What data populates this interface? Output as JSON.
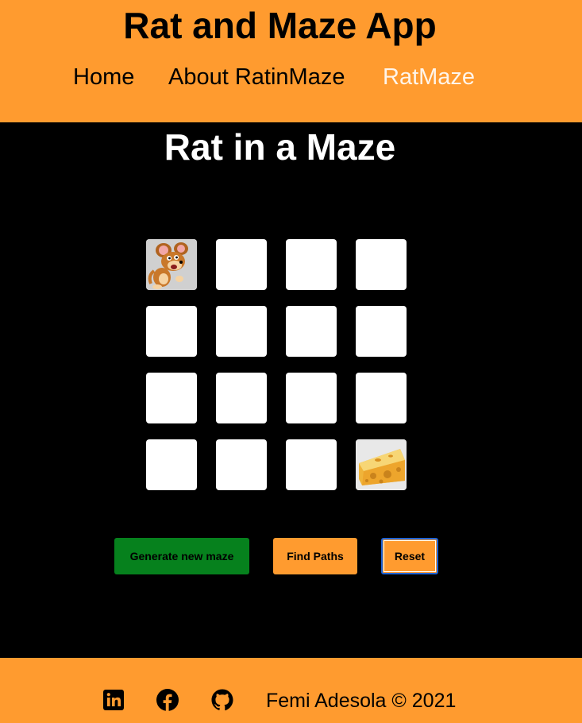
{
  "header": {
    "title": "Rat and Maze App",
    "nav": [
      {
        "label": "Home"
      },
      {
        "label": "About RatinMaze"
      },
      {
        "label": "RatMaze"
      }
    ],
    "active_nav": "RatMaze",
    "background": "#ff9b2f"
  },
  "main": {
    "title": "Rat in a Maze",
    "background": "#000000",
    "maze": {
      "rows": 4,
      "cols": 4,
      "start_cell": "rat-icon",
      "goal_cell": "cheese-icon",
      "cell_color": "#ffffff"
    },
    "buttons": {
      "generate": "Generate new maze",
      "find": "Find Paths",
      "reset": "Reset"
    },
    "colors": {
      "generate": "#06811d",
      "accent": "#ff9b2f",
      "focus": "#1d63d8"
    }
  },
  "footer": {
    "icons": [
      "linkedin-icon",
      "facebook-icon",
      "github-icon"
    ],
    "copyright": "Femi Adesola © 2021"
  }
}
